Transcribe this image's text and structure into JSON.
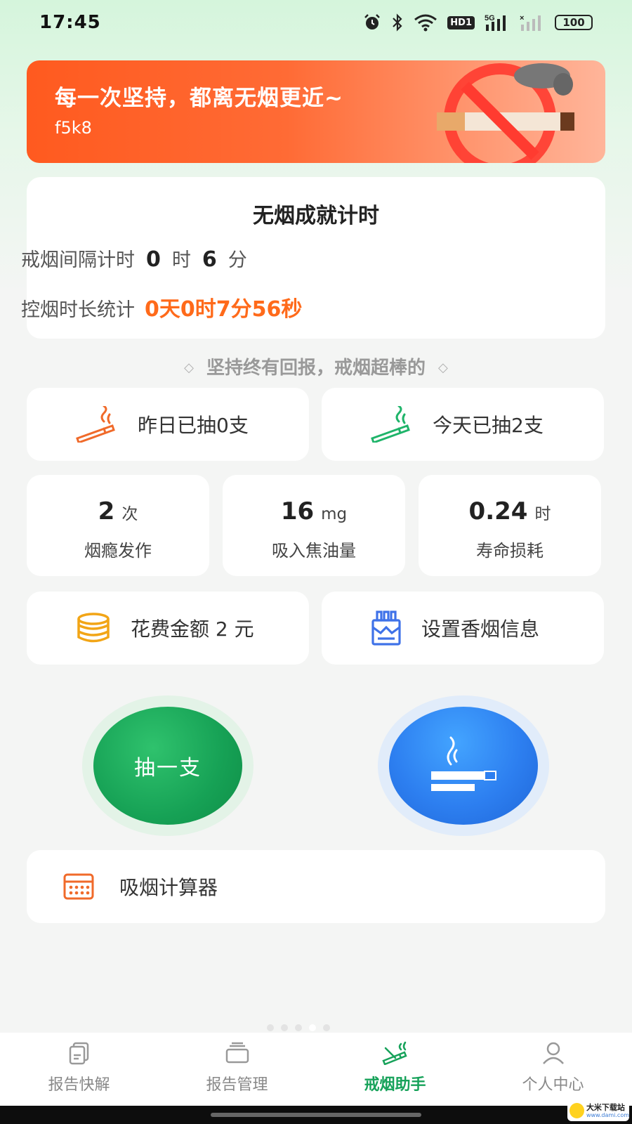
{
  "status_bar": {
    "time": "17:45",
    "battery": "100",
    "hd": "HD1",
    "network": "5G",
    "icons": [
      "alarm-icon",
      "bluetooth-icon",
      "wifi-icon",
      "hd-icon",
      "signal-icon",
      "signal-icon",
      "battery-icon"
    ]
  },
  "banner": {
    "title": "每一次坚持，都离无烟更近~",
    "subtitle": "f5k8",
    "icon": "no-smoking-icon"
  },
  "timer": {
    "title": "无烟成就计时",
    "interval_label": "戒烟间隔计时",
    "interval_hours": "0",
    "hour_unit": "时",
    "interval_minutes": "6",
    "minute_unit": "分",
    "duration_label": "控烟时长统计",
    "duration_value": "0天0时7分56秒"
  },
  "motto": "坚持终有回报，戒烟超棒的",
  "smoked": {
    "yesterday": "昨日已抽0支",
    "today": "今天已抽2支"
  },
  "stats": [
    {
      "value": "2",
      "unit": "次",
      "label": "烟瘾发作"
    },
    {
      "value": "16",
      "unit": "mg",
      "label": "吸入焦油量"
    },
    {
      "value": "0.24",
      "unit": "时",
      "label": "寿命损耗"
    }
  ],
  "money": {
    "label": "花费金额 2 元"
  },
  "set_info": {
    "label": "设置香烟信息"
  },
  "actions": {
    "smoke_one": "抽一支",
    "quit_icon": "cigarette-icon"
  },
  "calculator": {
    "label": "吸烟计算器"
  },
  "tabs": [
    {
      "label": "报告快解",
      "icon": "document-icon",
      "active": false
    },
    {
      "label": "报告管理",
      "icon": "folder-icon",
      "active": false
    },
    {
      "label": "戒烟助手",
      "icon": "cigarette-icon",
      "active": true
    },
    {
      "label": "个人中心",
      "icon": "person-icon",
      "active": false
    }
  ],
  "watermark": {
    "text": "大米下载站",
    "url": "www.dami.com"
  },
  "colors": {
    "accent_green": "#17a25a",
    "accent_orange": "#ff6a1a",
    "accent_blue": "#2d7ff0"
  }
}
